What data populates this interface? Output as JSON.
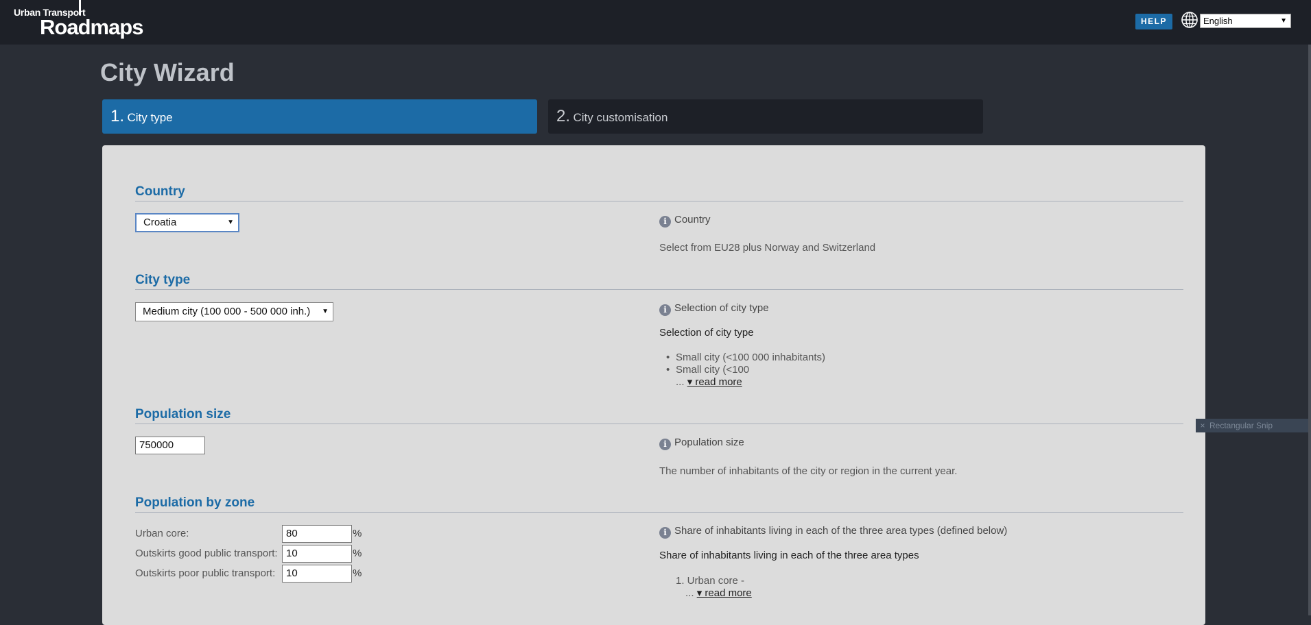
{
  "header": {
    "logo_small": "Urban Transport",
    "logo_big": "Roadmaps",
    "help_label": "HELP",
    "language": "English"
  },
  "page_title": "City Wizard",
  "tabs": [
    {
      "num": "1.",
      "label": "City type",
      "active": true
    },
    {
      "num": "2.",
      "label": "City customisation",
      "active": false
    }
  ],
  "sections": {
    "country": {
      "title": "Country",
      "value": "Croatia",
      "info_title": "Country",
      "info_text": "Select from EU28 plus Norway and Switzerland"
    },
    "city_type": {
      "title": "City type",
      "value": "Medium city (100 000 - 500 000 inh.)",
      "info_title": "Selection of city type",
      "info_heading": "Selection of city type",
      "list": [
        "Small city (<100 000 inhabitants)",
        "Small city (<100"
      ],
      "ellipsis": "...",
      "read_more": "▾ read more"
    },
    "population_size": {
      "title": "Population size",
      "value": "750000",
      "info_title": "Population size",
      "info_text": "The number of inhabitants of the city or region in the current year."
    },
    "population_by_zone": {
      "title": "Population by zone",
      "rows": [
        {
          "label": "Urban core:",
          "value": "80",
          "unit": "%"
        },
        {
          "label": "Outskirts good public transport:",
          "value": "10",
          "unit": "%"
        },
        {
          "label": "Outskirts poor public transport:",
          "value": "10",
          "unit": "%"
        }
      ],
      "info_title": "Share of inhabitants living in each of the three area types (defined below)",
      "info_heading": "Share of inhabitants living in each of the three area types",
      "list_item": "1. Urban core -",
      "ellipsis": "...",
      "read_more": "▾ read more"
    }
  },
  "snip_label": "Rectangular Snip"
}
